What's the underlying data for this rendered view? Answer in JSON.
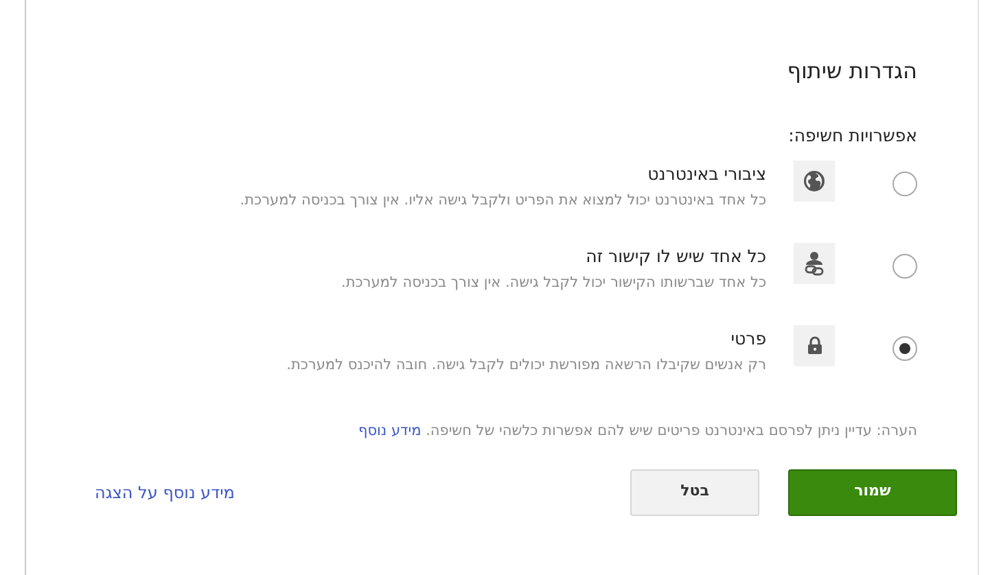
{
  "dialog": {
    "title": "הגדרות שיתוף",
    "section_label": "אפשרויות חשיפה:",
    "options": [
      {
        "kind": "globe",
        "title": "ציבורי באינטרנט",
        "description": "כל אחד באינטרנט יכול למצוא את הפריט ולקבל גישה אליו. אין צורך בכניסה למערכת.",
        "selected": false
      },
      {
        "kind": "link",
        "title": "כל אחד שיש לו קישור זה",
        "description": "כל אחד שברשותו הקישור יכול לקבל גישה. אין צורך בכניסה למערכת.",
        "selected": false
      },
      {
        "kind": "lock",
        "title": "פרטי",
        "description": "רק אנשים שקיבלו הרשאה מפורשת יכולים לקבל גישה. חובה להיכנס למערכת.",
        "selected": true
      }
    ],
    "note": "הערה: עדיין ניתן לפרסם באינטרנט פריטים שיש להם אפשרות כלשהי של חשיפה.",
    "note_link": "מידע נוסף",
    "save_button": "שמור",
    "cancel_button": "בטל",
    "help_link": "מידע נוסף על הצגה"
  }
}
